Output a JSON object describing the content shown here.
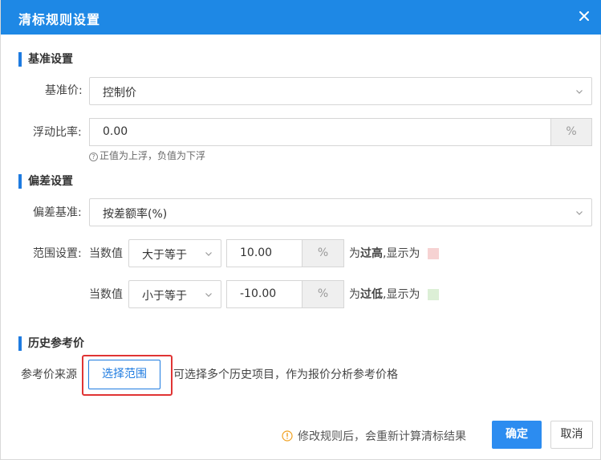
{
  "dialog": {
    "title": "清标规则设置",
    "close_icon": "close-icon"
  },
  "baseline": {
    "section_title": "基准设置",
    "price_label": "基准价:",
    "price_value": "控制价",
    "float_label": "浮动比率:",
    "float_value": "0.00",
    "float_unit": "%",
    "float_hint": "正值为上浮，负值为下浮"
  },
  "deviation": {
    "section_title": "偏差设置",
    "basis_label": "偏差基准:",
    "basis_value": "按差额率(%)",
    "range_label": "范围设置:",
    "high": {
      "prefix": "当数值",
      "operator": "大于等于",
      "value": "10.00",
      "unit": "%",
      "suffix_pre": "为",
      "suffix_bold": "过高",
      "suffix_post": ",显示为",
      "color": "#f6d2d2"
    },
    "low": {
      "prefix": "当数值",
      "operator": "小于等于",
      "value": "-10.00",
      "unit": "%",
      "suffix_pre": "为",
      "suffix_bold": "过低",
      "suffix_post": ",显示为",
      "color": "#dcefd6"
    }
  },
  "history": {
    "section_title": "历史参考价",
    "source_label": "参考价来源",
    "select_button": "选择范围",
    "description": "可选择多个历史项目，作为报价分析参考价格"
  },
  "footer": {
    "hint": "修改规则后，会重新计算清标结果",
    "confirm": "确定",
    "cancel": "取消"
  },
  "colors": {
    "primary": "#1e88e5",
    "accent_bar": "#1e7be0",
    "highlight_border": "#e03434"
  }
}
